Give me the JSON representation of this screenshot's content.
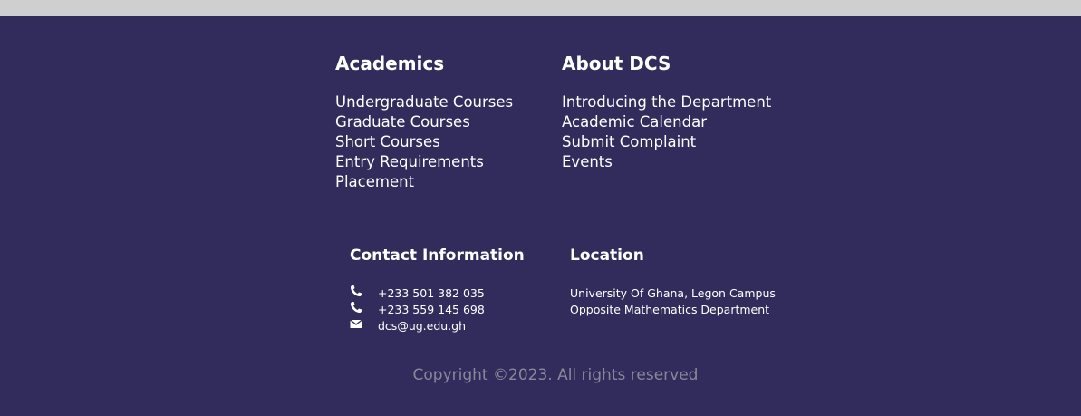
{
  "footer": {
    "academics": {
      "heading": "Academics",
      "links": [
        "Undergraduate Courses",
        "Graduate Courses",
        "Short Courses",
        "Entry Requirements",
        "Placement"
      ]
    },
    "about": {
      "heading": "About DCS",
      "links": [
        "Introducing the Department",
        "Academic Calendar",
        "Submit Complaint",
        "Events"
      ]
    },
    "contact": {
      "heading": "Contact Information",
      "items": [
        {
          "icon": "phone-icon",
          "text": "+233 501 382 035"
        },
        {
          "icon": "phone-icon",
          "text": "+233 559 145 698"
        },
        {
          "icon": "mail-icon",
          "text": "dcs@ug.edu.gh"
        }
      ]
    },
    "location": {
      "heading": "Location",
      "lines": [
        "University Of Ghana, Legon Campus",
        "Opposite Mathematics Department"
      ]
    },
    "copyright": "Copyright ©2023. All rights reserved",
    "colors": {
      "background": "#312c5c",
      "text": "#ffffff",
      "muted": "#8a8799",
      "top_strip": "#cfcfcf"
    }
  }
}
